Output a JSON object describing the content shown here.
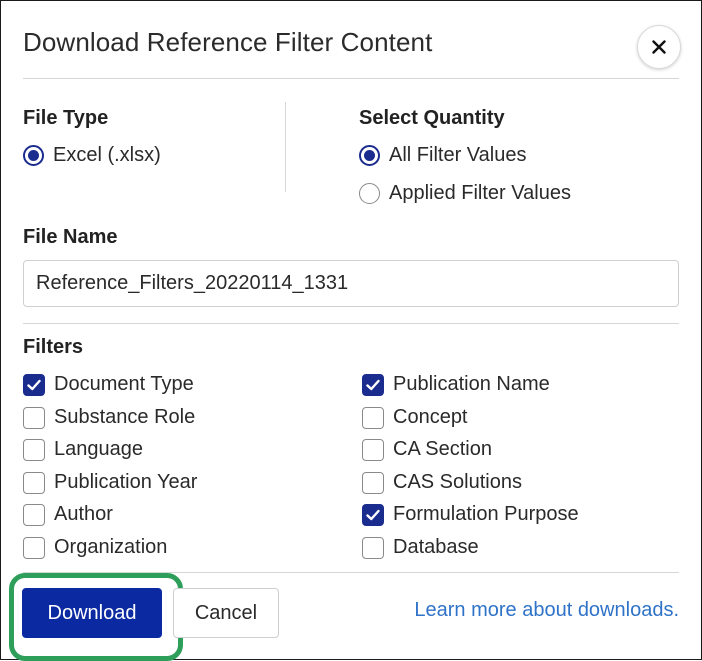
{
  "dialog": {
    "title": "Download Reference Filter Content",
    "close_icon": "close-icon"
  },
  "file_type": {
    "label": "File Type",
    "options": [
      {
        "label": "Excel (.xlsx)",
        "selected": true
      }
    ]
  },
  "select_quantity": {
    "label": "Select Quantity",
    "options": [
      {
        "label": "All Filter Values",
        "selected": true
      },
      {
        "label": "Applied Filter Values",
        "selected": false
      }
    ]
  },
  "file_name": {
    "label": "File Name",
    "value": "Reference_Filters_20220114_1331"
  },
  "filters": {
    "label": "Filters",
    "left": [
      {
        "label": "Document Type",
        "checked": true
      },
      {
        "label": "Substance Role",
        "checked": false
      },
      {
        "label": "Language",
        "checked": false
      },
      {
        "label": "Publication Year",
        "checked": false
      },
      {
        "label": "Author",
        "checked": false
      },
      {
        "label": "Organization",
        "checked": false
      }
    ],
    "right": [
      {
        "label": "Publication Name",
        "checked": true
      },
      {
        "label": "Concept",
        "checked": false
      },
      {
        "label": "CA Section",
        "checked": false
      },
      {
        "label": "CAS Solutions",
        "checked": false
      },
      {
        "label": "Formulation Purpose",
        "checked": true
      },
      {
        "label": "Database",
        "checked": false
      }
    ]
  },
  "footer": {
    "download_label": "Download",
    "cancel_label": "Cancel",
    "learn_more_label": "Learn more about downloads."
  },
  "colors": {
    "primary": "#0b2aa2",
    "selection": "#1a2d8f",
    "link": "#2f73c8",
    "highlight": "#2e9e5b"
  }
}
